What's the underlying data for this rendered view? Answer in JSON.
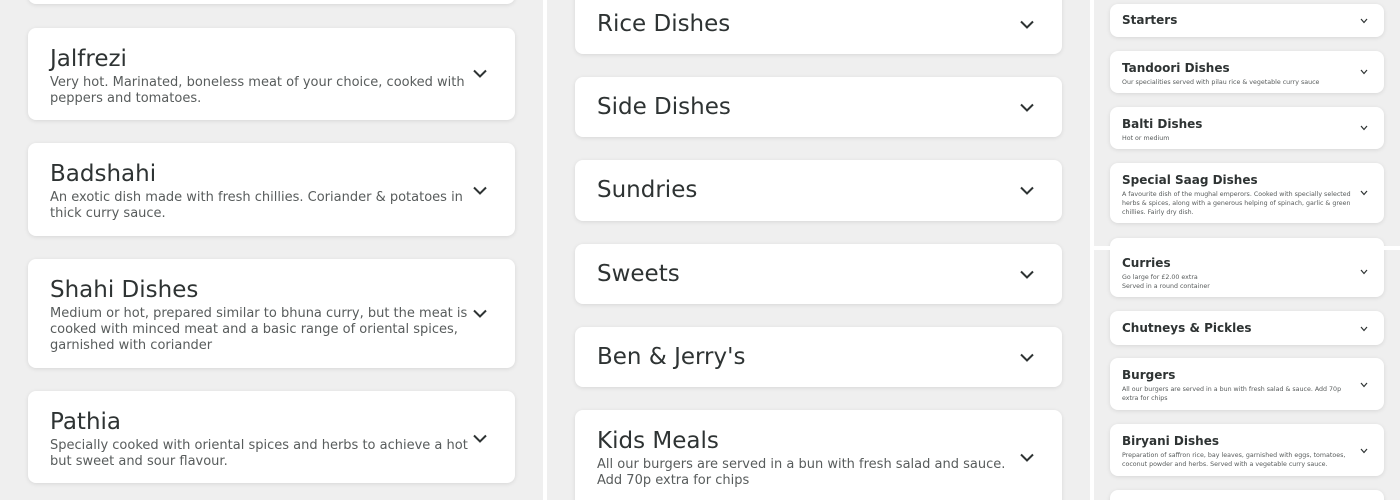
{
  "left": [
    {
      "title": "",
      "desc": ""
    },
    {
      "title": "Jalfrezi",
      "desc": "Very hot. Marinated, boneless meat of your choice, cooked with peppers and tomatoes."
    },
    {
      "title": "Badshahi",
      "desc": "An exotic dish made with fresh chillies. Coriander & potatoes in thick curry sauce."
    },
    {
      "title": "Shahi Dishes",
      "desc": "Medium or hot, prepared similar to bhuna curry, but the meat is cooked with minced meat and a basic range of oriental spices, garnished with coriander"
    },
    {
      "title": "Pathia",
      "desc": "Specially cooked with oriental spices and herbs to achieve a hot but sweet and sour flavour."
    }
  ],
  "middle": [
    {
      "title": "Rice Dishes",
      "desc": ""
    },
    {
      "title": "Side Dishes",
      "desc": ""
    },
    {
      "title": "Sundries",
      "desc": ""
    },
    {
      "title": "Sweets",
      "desc": ""
    },
    {
      "title": "Ben & Jerry's",
      "desc": ""
    },
    {
      "title": "Kids Meals",
      "desc": "All our burgers are served in a bun with fresh salad and sauce. Add 70p extra for chips"
    }
  ],
  "right": [
    {
      "title": "Starters",
      "desc": ""
    },
    {
      "title": "Tandoori Dishes",
      "desc": "Our specialities served with pilau rice & vegetable curry sauce"
    },
    {
      "title": "Balti Dishes",
      "desc": "Hot or medium"
    },
    {
      "title": "Special Saag Dishes",
      "desc": "A favourite dish of the mughal emperors. Cooked with specially selected herbs & spices, along with a generous helping of spinach, garlic & green chillies. Fairly dry dish."
    },
    {
      "title": "Curries",
      "desc": "Go large for £2.00 extra",
      "desc2": "Served in a round container"
    },
    {
      "title": "Chutneys & Pickles",
      "desc": ""
    },
    {
      "title": "Burgers",
      "desc": "All our burgers are served in a bun with fresh salad & sauce. Add 70p extra for chips"
    },
    {
      "title": "Biryani Dishes",
      "desc": "Preparation of saffron rice, bay leaves, garnished with eggs, tomatoes, coconut powder and herbs. Served with a vegetable curry sauce."
    },
    {
      "title": "",
      "desc": ""
    }
  ],
  "icons": {
    "expand": "chevron-down-icon"
  },
  "colors": {
    "background": "#efefef",
    "card": "#ffffff",
    "text": "#2e3333",
    "muted": "#585c5c"
  }
}
